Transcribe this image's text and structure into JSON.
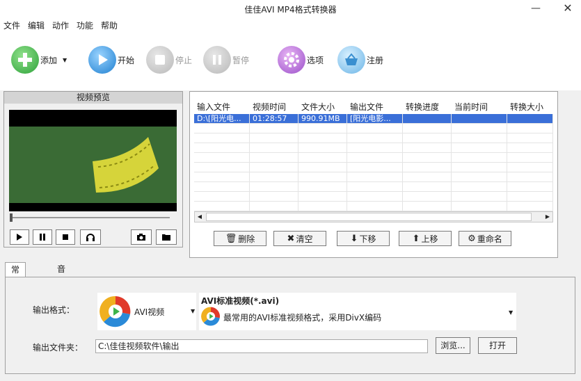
{
  "window": {
    "title": "佳佳AVI MP4格式转换器",
    "minimize": "—",
    "close": "✕"
  },
  "menu": [
    "文件",
    "编辑",
    "动作",
    "功能",
    "帮助"
  ],
  "toolbar": {
    "add": "添加",
    "start": "开始",
    "stop": "停止",
    "pause": "暂停",
    "options": "选项",
    "register": "注册"
  },
  "preview": {
    "header": "视频预览"
  },
  "file_list": {
    "columns": [
      "输入文件",
      "视频时间",
      "文件大小",
      "输出文件",
      "转换进度",
      "当前时间",
      "转换大小"
    ],
    "rows": [
      [
        "D:\\[阳光电...",
        "01:28:57",
        "990.91MB",
        "[阳光电影...",
        "",
        "",
        ""
      ]
    ]
  },
  "list_buttons": {
    "delete": "删除",
    "clear": "清空",
    "down": "下移",
    "up": "上移",
    "rename": "重命名"
  },
  "tabs": [
    "常规设置",
    "音视频高级设置"
  ],
  "settings": {
    "output_format_label": "输出格式：",
    "output_format_value": "AVI视频",
    "format_title": "AVI标准视频(*.avi)",
    "format_desc": "最常用的AVI标准视频格式，采用DivX编码",
    "output_folder_label": "输出文件夹：",
    "output_folder_value": "C:\\佳佳视频软件\\输出",
    "browse": "浏览...",
    "open": "打开"
  },
  "colors": {
    "selection": "#3a6fd8",
    "accent_green": "#3cb44a",
    "accent_blue": "#2a8ad8"
  }
}
